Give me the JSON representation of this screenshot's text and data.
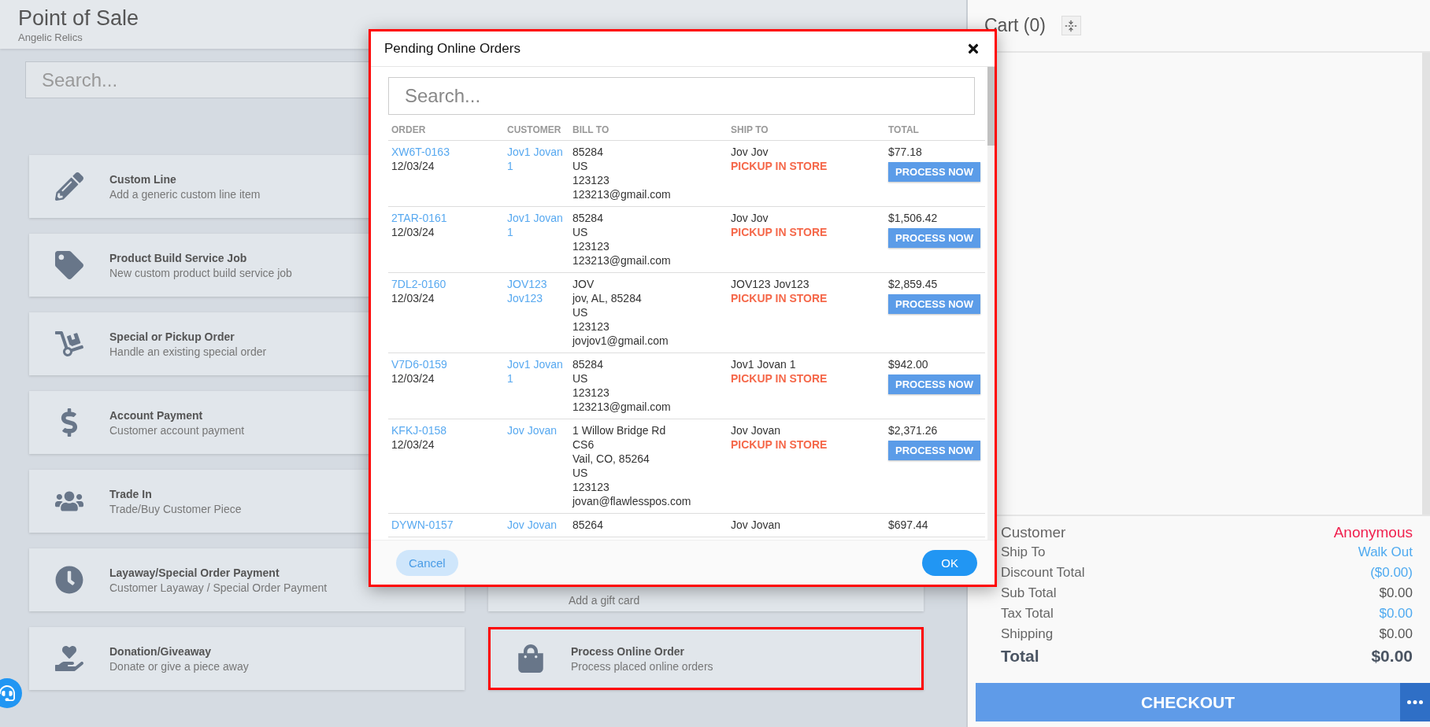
{
  "header": {
    "title": "Point of Sale",
    "subtitle": "Angelic Relics"
  },
  "search": {
    "placeholder": "Search..."
  },
  "left_tiles": [
    {
      "title": "Custom Line",
      "description": "Add a generic custom line item",
      "highlighted": false
    },
    {
      "title": "Product Build Service Job",
      "description": "New custom product build service job",
      "highlighted": false
    },
    {
      "title": "Special or Pickup Order",
      "description": "Handle an existing special order",
      "highlighted": false
    },
    {
      "title": "Account Payment",
      "description": "Customer account payment",
      "highlighted": false
    },
    {
      "title": "Trade In",
      "description": "Trade/Buy Customer Piece",
      "highlighted": false
    },
    {
      "title": "Layaway/Special Order Payment",
      "description": "Customer Layaway / Special Order Payment",
      "highlighted": false
    },
    {
      "title": "Donation/Giveaway",
      "description": "Donate or give a piece away",
      "highlighted": false
    }
  ],
  "right_tiles": [
    {
      "description": "Add a gift card",
      "highlighted": false
    },
    {
      "title": "Process Online Order",
      "description": "Process placed online orders",
      "highlighted": true
    }
  ],
  "cart": {
    "title": "Cart (0)"
  },
  "summary": [
    {
      "label": "Customer",
      "value": "Anonymous",
      "kind": "customer"
    },
    {
      "label": "Ship To",
      "value": "Walk Out",
      "kind": "link"
    },
    {
      "label": "Discount Total",
      "value": "($0.00)",
      "kind": "link"
    },
    {
      "label": "Sub Total",
      "value": "$0.00",
      "kind": "plain"
    },
    {
      "label": "Tax Total",
      "value": "$0.00",
      "kind": "link"
    },
    {
      "label": "Shipping",
      "value": "$0.00",
      "kind": "plain"
    },
    {
      "label": "Total",
      "value": "$0.00",
      "kind": "total"
    }
  ],
  "checkout": {
    "label": "CHECKOUT"
  },
  "modal": {
    "title": "Pending Online Orders",
    "highlighted": true,
    "search_placeholder": "Search...",
    "columns": [
      "ORDER",
      "CUSTOMER",
      "BILL TO",
      "SHIP TO",
      "TOTAL"
    ],
    "orders": [
      {
        "order": "XW6T-0163",
        "date": "12/03/24",
        "customer": "Jov1 Jovan 1",
        "bill_to": [
          "85284",
          "US",
          "123123",
          "123213@gmail.com"
        ],
        "ship_name": "Jov Jov",
        "ship_method": "PICKUP IN STORE",
        "total": "$77.18",
        "action": "PROCESS NOW"
      },
      {
        "order": "2TAR-0161",
        "date": "12/03/24",
        "customer": "Jov1 Jovan 1",
        "bill_to": [
          "85284",
          "US",
          "123123",
          "123213@gmail.com"
        ],
        "ship_name": "Jov Jov",
        "ship_method": "PICKUP IN STORE",
        "total": "$1,506.42",
        "action": "PROCESS NOW"
      },
      {
        "order": "7DL2-0160",
        "date": "12/03/24",
        "customer": "JOV123 Jov123",
        "bill_to": [
          "JOV",
          "jov, AL, 85284",
          "US",
          "123123",
          "jovjov1@gmail.com"
        ],
        "ship_name": "JOV123 Jov123",
        "ship_method": "PICKUP IN STORE",
        "total": "$2,859.45",
        "action": "PROCESS NOW"
      },
      {
        "order": "V7D6-0159",
        "date": "12/03/24",
        "customer": "Jov1 Jovan 1",
        "bill_to": [
          "85284",
          "US",
          "123123",
          "123213@gmail.com"
        ],
        "ship_name": "Jov1 Jovan 1",
        "ship_method": "PICKUP IN STORE",
        "total": "$942.00",
        "action": "PROCESS NOW"
      },
      {
        "order": "KFKJ-0158",
        "date": "12/03/24",
        "customer": "Jov Jovan",
        "bill_to": [
          "1 Willow Bridge Rd",
          "CS6",
          "Vail, CO, 85264",
          "US",
          "123123",
          "jovan@flawlesspos.com"
        ],
        "ship_name": "Jov Jovan",
        "ship_method": "PICKUP IN STORE",
        "total": "$2,371.26",
        "action": "PROCESS NOW"
      },
      {
        "order": "DYWN-0157",
        "customer": "Jov Jovan",
        "bill_to": [
          "85264"
        ],
        "ship_name": "Jov Jovan",
        "total": "$697.44"
      }
    ],
    "cancel": "Cancel",
    "ok": "OK"
  }
}
